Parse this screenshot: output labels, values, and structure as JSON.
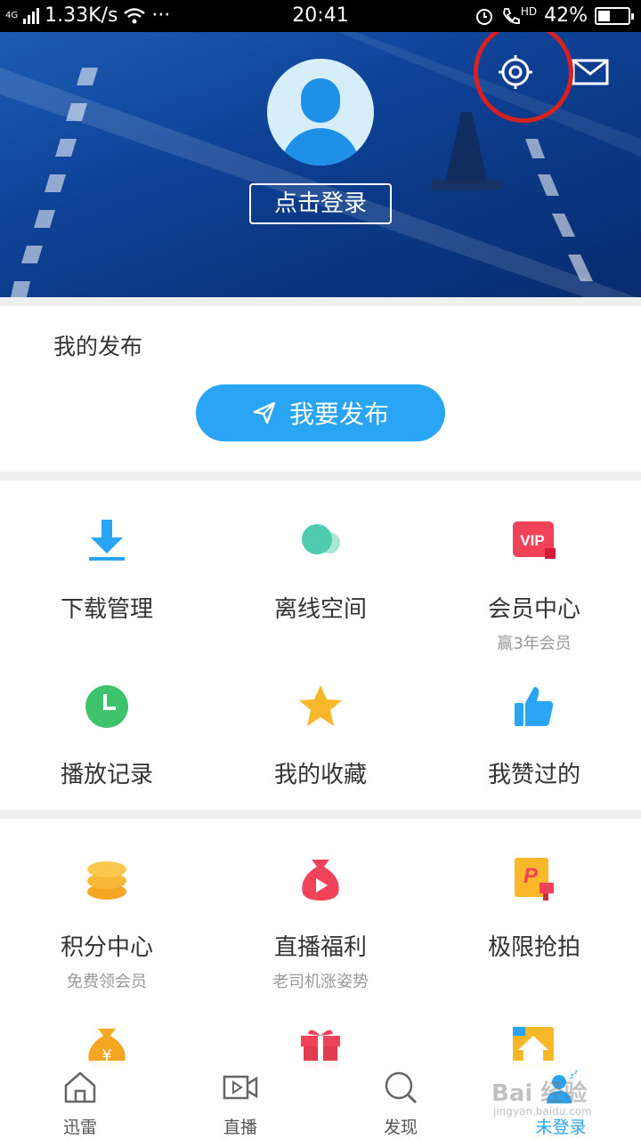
{
  "status_bar": {
    "network": "4G",
    "speed": "1.33K/s",
    "more": "···",
    "time": "20:41",
    "hd": "HD",
    "battery": "42%",
    "battery_level": 0.42
  },
  "header": {
    "login_label": "点击登录"
  },
  "publish": {
    "title": "我的发布",
    "button_label": "我要发布"
  },
  "grid1": [
    {
      "label": "下载管理",
      "sub": "",
      "icon": "download-icon"
    },
    {
      "label": "离线空间",
      "sub": "",
      "icon": "cloud-icon"
    },
    {
      "label": "会员中心",
      "sub": "赢3年会员",
      "icon": "vip-icon",
      "icon_text": "VIP"
    },
    {
      "label": "播放记录",
      "sub": "",
      "icon": "clock-icon"
    },
    {
      "label": "我的收藏",
      "sub": "",
      "icon": "star-icon"
    },
    {
      "label": "我赞过的",
      "sub": "",
      "icon": "thumbs-up-icon"
    }
  ],
  "grid2": [
    {
      "label": "积分中心",
      "sub": "免费领会员",
      "icon": "coins-icon"
    },
    {
      "label": "直播福利",
      "sub": "老司机涨姿势",
      "icon": "money-bag-play-icon"
    },
    {
      "label": "极限抢拍",
      "sub": "",
      "icon": "auction-icon",
      "icon_text": "P"
    },
    {
      "label": "",
      "sub": "",
      "icon": "money-bag-icon",
      "icon_text": "¥"
    },
    {
      "label": "",
      "sub": "",
      "icon": "gift-icon"
    },
    {
      "label": "",
      "sub": "",
      "icon": "home-icon"
    }
  ],
  "bottom_nav": [
    {
      "label": "迅雷",
      "icon": "house-icon",
      "active": false
    },
    {
      "label": "直播",
      "icon": "video-icon",
      "active": false
    },
    {
      "label": "发现",
      "icon": "search-icon",
      "active": false
    },
    {
      "label": "未登录",
      "icon": "user-sleep-icon",
      "active": true
    }
  ],
  "watermark": {
    "main": "Bai 经验",
    "sub": "jingyan.baidu.com"
  },
  "colors": {
    "accent": "#2aa4f4",
    "header_bg": "#0d3f92",
    "annotation_red": "#d42222"
  }
}
